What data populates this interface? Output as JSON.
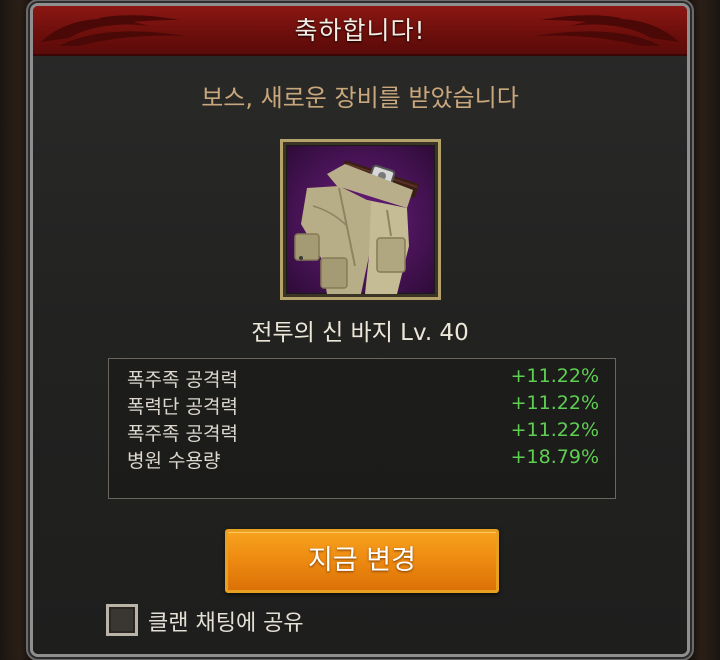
{
  "dialog": {
    "title": "축하합니다!",
    "subtitle": "보스, 새로운 장비를 받았습니다",
    "item": {
      "name": "전투의 신 바지  Lv. 40",
      "icon": "cargo-pants-icon",
      "rarity_color": "#5a1a6e"
    },
    "stats": [
      {
        "label": "폭주족 공격력",
        "value": "+11.22%"
      },
      {
        "label": "폭력단 공격력",
        "value": "+11.22%"
      },
      {
        "label": "폭주족 공격력",
        "value": "+11.22%"
      },
      {
        "label": "병원 수용량",
        "value": "+18.79%"
      }
    ],
    "change_button_label": "지금 변경",
    "share_checkbox": {
      "label": "클랜 채팅에 공유",
      "checked": false
    }
  },
  "colors": {
    "header": "#7a1410",
    "subtitle": "#c9a77d",
    "stat_value": "#5fcf52",
    "button": "#ee8c12"
  }
}
